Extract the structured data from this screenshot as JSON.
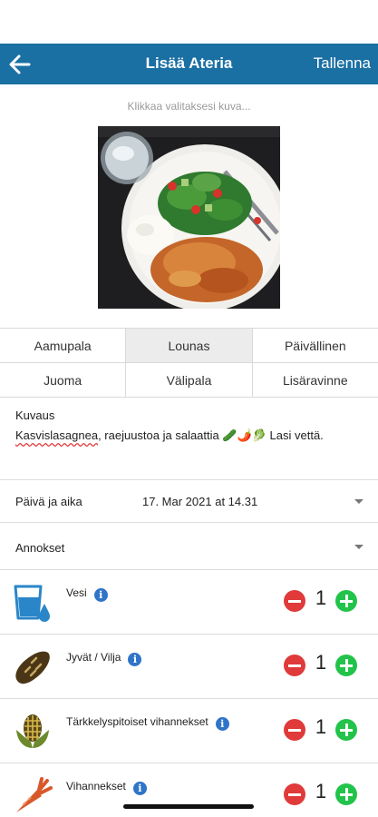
{
  "navbar": {
    "back_icon": "arrow-left-icon",
    "title": "Lisää Ateria",
    "save_label": "Tallenna"
  },
  "photo": {
    "hint": "Klikkaa valitaksesi kuva..."
  },
  "categories": [
    [
      {
        "label": "Aamupala",
        "selected": false
      },
      {
        "label": "Lounas",
        "selected": true
      },
      {
        "label": "Päivällinen",
        "selected": false
      }
    ],
    [
      {
        "label": "Juoma",
        "selected": false
      },
      {
        "label": "Välipala",
        "selected": false
      },
      {
        "label": "Lisäravinne",
        "selected": false
      }
    ]
  ],
  "description": {
    "label": "Kuvaus",
    "text_spelled": "Kasvislasagnea",
    "text_rest": ", raejuustoa ja salaattia 🥒🌶️🥬 Lasi vettä."
  },
  "datetime": {
    "label": "Päivä ja aika",
    "value": "17. Mar 2021 at 14.31"
  },
  "portions_header": {
    "label": "Annokset"
  },
  "portions": [
    {
      "label": "Vesi",
      "count": "1",
      "icon": "water-glass-icon"
    },
    {
      "label": "Jyvät / Vilja",
      "count": "1",
      "icon": "bread-icon"
    },
    {
      "label": "Tärkkelyspitoiset vihannekset",
      "count": "1",
      "icon": "corn-icon"
    },
    {
      "label": "Vihannekset",
      "count": "1",
      "icon": "carrot-icon"
    }
  ],
  "colors": {
    "navbar": "#1a6fa3",
    "minus": "#e03a3a",
    "plus": "#22c34a",
    "info": "#2f74c8"
  }
}
